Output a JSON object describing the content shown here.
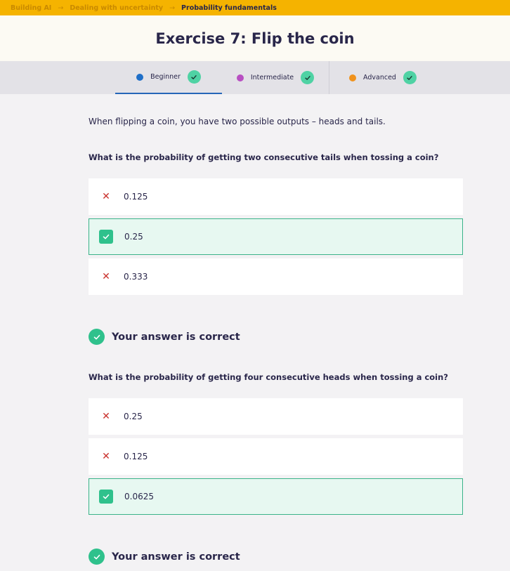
{
  "breadcrumb": {
    "items": [
      "Building AI",
      "Dealing with uncertainty",
      "Probability fundamentals"
    ],
    "separator": "→"
  },
  "title": "Exercise 7: Flip the coin",
  "levels": [
    {
      "label": "Beginner",
      "color": "#1f6fc8",
      "completed": true,
      "active": true
    },
    {
      "label": "Intermediate",
      "color": "#b84fc2",
      "completed": true,
      "active": false
    },
    {
      "label": "Advanced",
      "color": "#f0921c",
      "completed": true,
      "active": false
    }
  ],
  "intro": "When flipping a coin, you have two possible outputs – heads and tails.",
  "questions": [
    {
      "text": "What is the probability of getting two consecutive tails when tossing a coin?",
      "options": [
        {
          "label": "0.125",
          "state": "wrong"
        },
        {
          "label": "0.25",
          "state": "correct"
        },
        {
          "label": "0.333",
          "state": "wrong"
        }
      ],
      "feedback": "Your answer is correct"
    },
    {
      "text": "What is the probability of getting four consecutive heads when tossing a coin?",
      "options": [
        {
          "label": "0.25",
          "state": "wrong"
        },
        {
          "label": "0.125",
          "state": "wrong"
        },
        {
          "label": "0.0625",
          "state": "correct"
        }
      ],
      "feedback": "Your answer is correct"
    }
  ],
  "icons": {
    "wrong": "x-icon",
    "correct": "checkmark-icon",
    "feedback": "check-circle-icon"
  }
}
